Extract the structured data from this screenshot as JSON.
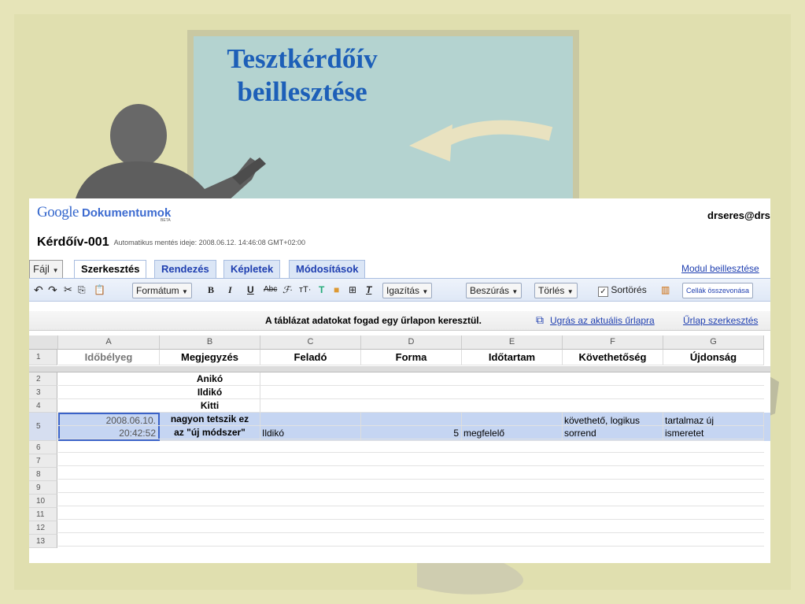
{
  "slide": {
    "title_line1": "Tesztkérdőív",
    "title_line2": "beillesztése"
  },
  "app": {
    "logo_google": "Google",
    "logo_product": "Dokumentumok",
    "logo_badge": "BETA",
    "user": "drseres@drs"
  },
  "doc": {
    "title": "Kérdőív-001",
    "autosave": "Automatikus mentés ideje: 2008.06.12. 14:46:08 GMT+02:00"
  },
  "menu": {
    "file": "Fájl",
    "tabs": [
      "Szerkesztés",
      "Rendezés",
      "Képletek",
      "Módosítások"
    ],
    "insert_module": "Modul beillesztése"
  },
  "toolbar": {
    "format": "Formátum",
    "align": "Igazítás",
    "insert": "Beszúrás",
    "delete": "Törlés",
    "wrap": "Sortörés",
    "wrap_checked": true,
    "merge": "Cellák összevonása"
  },
  "notice": {
    "text": "A táblázat adatokat fogad egy űrlapon keresztül.",
    "goto_form": "Ugrás az aktuális űrlapra",
    "edit_form": "Űrlap szerkesztés"
  },
  "grid": {
    "columns": [
      "A",
      "B",
      "C",
      "D",
      "E",
      "F",
      "G"
    ],
    "headers": [
      "Időbélyeg",
      "Megjegyzés",
      "Feladó",
      "Forma",
      "Időtartam",
      "Követhetőség",
      "Újdonság"
    ],
    "row_numbers": [
      "1",
      "2",
      "3",
      "4",
      "5",
      "6",
      "7",
      "8",
      "9",
      "10",
      "11",
      "12",
      "13"
    ],
    "names": [
      "Anikó",
      "Ildikó",
      "Kitti"
    ],
    "row5": {
      "a_line1": "2008.06.10.",
      "a_line2": "20:42:52",
      "b_line1": "nagyon tetszik ez",
      "b_line2": "az \"új módszer\"",
      "c": "Ildikó",
      "d": "5",
      "e": "megfelelő",
      "f_line1": "követhető, logikus",
      "f_line2": "sorrend",
      "g_line1": "tartalmaz új",
      "g_line2": "ismeretet"
    }
  },
  "colors": {
    "accent_blue": "#1f3fb0",
    "title_blue": "#1d5fb8",
    "selected_row": "#c5d5f2"
  }
}
